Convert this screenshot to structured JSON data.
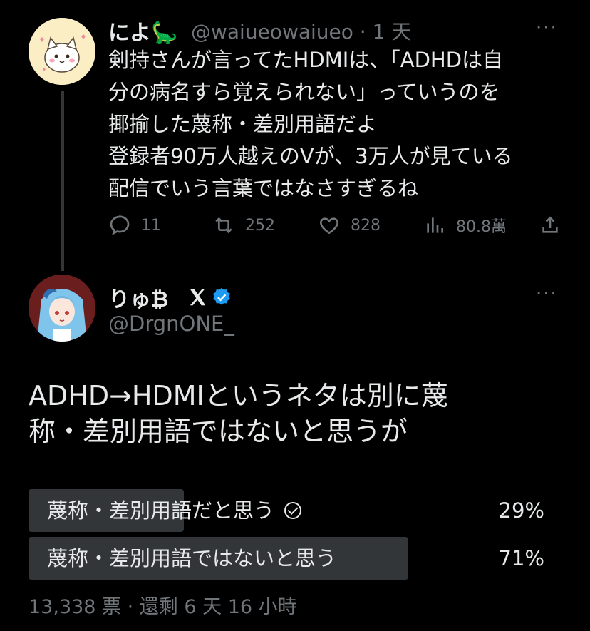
{
  "parent": {
    "display_name": "によ🦕",
    "handle": "@waiueowaiueo",
    "separator": "·",
    "time": "1 天",
    "more": "···",
    "lines": [
      "剣持さんが言ってたHDMIは、「ADHDは自",
      "分の病名すら覚えられない」っていうのを",
      "揶揄した蔑称・差別用語だよ",
      "登録者90万人越えのVが、3万人が見ている",
      "配信でいう言葉ではなさすぎるね"
    ],
    "actions": {
      "replies": "11",
      "retweets": "252",
      "likes": "828",
      "views": "80.8萬"
    }
  },
  "reply": {
    "display_name": "りゅ₿",
    "handle": "@DrgnONE_",
    "more": "···",
    "lines": [
      "ADHD→HDMIというネタは別に蔑",
      "称・差別用語ではないと思うが"
    ],
    "poll": {
      "options": [
        {
          "label": "蔑称・差別用語だと思う",
          "percent": "29%",
          "value": 0.29,
          "selected": true
        },
        {
          "label": "蔑称・差別用語ではないと思う",
          "percent": "71%",
          "value": 0.71,
          "selected": false
        }
      ],
      "footer": "13,338 票 · 還剩 6 天 16 小時"
    }
  },
  "colors": {
    "background": "#000000",
    "text": "#e7e9ea",
    "secondary": "#71767b",
    "poll_fill": "#333639",
    "verified": "#1d9bf0"
  }
}
